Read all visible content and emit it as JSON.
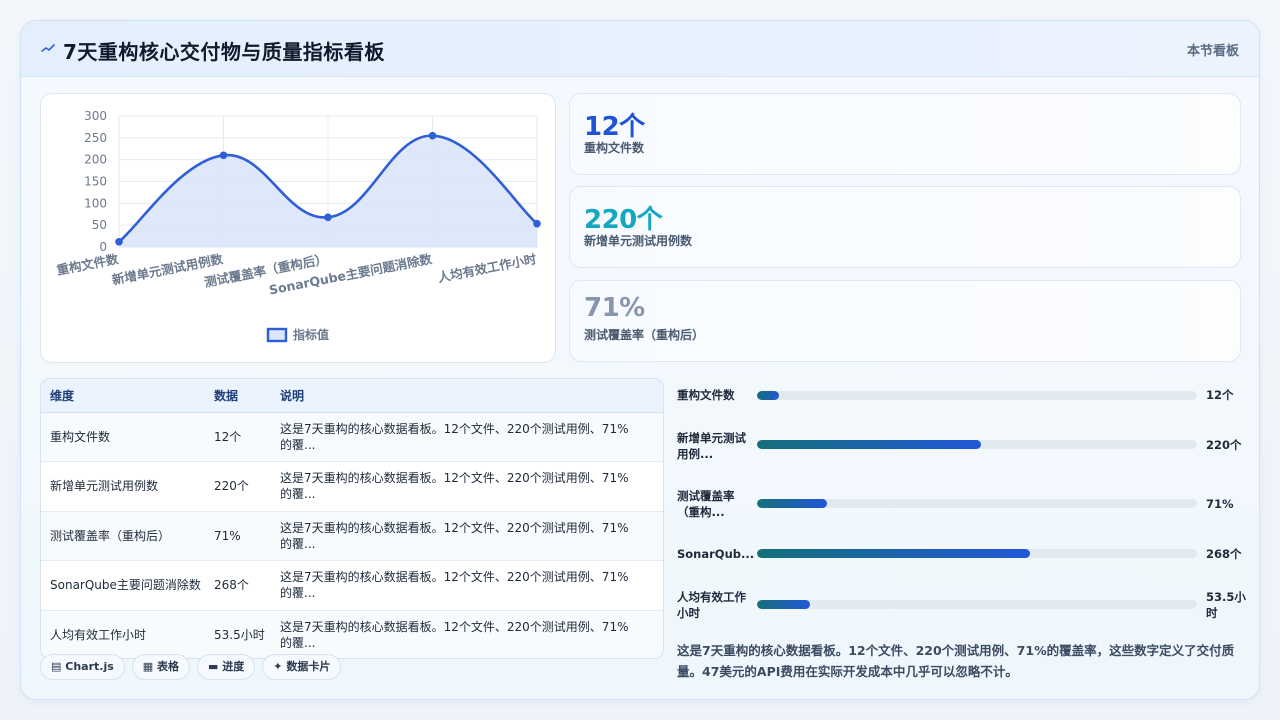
{
  "header": {
    "title": "7天重构核心交付物与质量指标看板",
    "action_label": "本节看板"
  },
  "chart_data": {
    "type": "line",
    "categories": [
      "重构文件数",
      "新增单元测试用例数",
      "测试覆盖率（重构后）",
      "SonarQube主要问题消除数",
      "人均有效工作小时"
    ],
    "series": [
      {
        "name": "指标值",
        "values": [
          12,
          210,
          68,
          255,
          53.5
        ]
      }
    ],
    "y_ticks": [
      "0",
      "50",
      "100",
      "150",
      "200",
      "250",
      "300"
    ],
    "ylim": [
      0,
      300
    ],
    "grid": true,
    "legend": "bottom",
    "line_color": "#2e5fd6",
    "fill_color": "#dce6fa"
  },
  "kpis": [
    {
      "value": "12个",
      "label": "重构文件数",
      "color": "#1f54d4"
    },
    {
      "value": "220个",
      "label": "新增单元测试用例数",
      "color": "#17a6c2"
    },
    {
      "value": "71%",
      "label": "测试覆盖率（重构后）",
      "color": "#8796ac"
    }
  ],
  "table": {
    "headers": [
      "维度",
      "数据",
      "说明"
    ],
    "rows": [
      {
        "dim": "重构文件数",
        "value": "12个",
        "desc": "这是7天重构的核心数据看板。12个文件、220个测试用例、71%的覆..."
      },
      {
        "dim": "新增单元测试用例数",
        "value": "220个",
        "desc": "这是7天重构的核心数据看板。12个文件、220个测试用例、71%的覆..."
      },
      {
        "dim": "测试覆盖率（重构后）",
        "value": "71%",
        "desc": "这是7天重构的核心数据看板。12个文件、220个测试用例、71%的覆..."
      },
      {
        "dim": "SonarQube主要问题消除数",
        "value": "268个",
        "desc": "这是7天重构的核心数据看板。12个文件、220个测试用例、71%的覆..."
      },
      {
        "dim": "人均有效工作小时",
        "value": "53.5小时",
        "desc": "这是7天重构的核心数据看板。12个文件、220个测试用例、71%的覆..."
      }
    ]
  },
  "tags": [
    {
      "icon": "chart-icon",
      "glyph": "▤",
      "label": "Chart.js"
    },
    {
      "icon": "table-icon",
      "glyph": "▦",
      "label": "表格"
    },
    {
      "icon": "progress-icon",
      "glyph": "▬",
      "label": "进度"
    },
    {
      "icon": "card-icon",
      "glyph": "✦",
      "label": "数据卡片"
    }
  ],
  "bars": [
    {
      "name": "重构文件数",
      "value": "12个",
      "fraction": 0.05
    },
    {
      "name": "新增单元测试用例...",
      "value": "220个",
      "fraction": 0.51
    },
    {
      "name": "测试覆盖率（重构...",
      "value": "71%",
      "fraction": 0.16
    },
    {
      "name": "SonarQub...",
      "value": "268个",
      "fraction": 0.62
    },
    {
      "name": "人均有效工作小时",
      "value": "53.5小时",
      "fraction": 0.12
    }
  ],
  "summary": "这是7天重构的核心数据看板。12个文件、220个测试用例、71%的覆盖率，这些数字定义了交付质量。47美元的API费用在实际开发成本中几乎可以忽略不计。"
}
